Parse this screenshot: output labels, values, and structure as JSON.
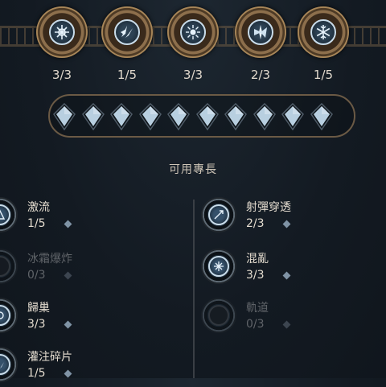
{
  "trees": [
    {
      "icon": "snowflake-wheel-icon",
      "count": "3/3"
    },
    {
      "icon": "ice-shards-icon",
      "count": "1/5"
    },
    {
      "icon": "frost-burst-icon",
      "count": "3/3"
    },
    {
      "icon": "ice-spikes-icon",
      "count": "2/3"
    },
    {
      "icon": "snowflake-icon",
      "count": "1/5"
    }
  ],
  "specialty_pips": {
    "filled": 10,
    "total": 10
  },
  "section_title": "可用專長",
  "talents_left": [
    {
      "name": "激流",
      "rank": "1/5",
      "locked": false
    },
    {
      "name": "冰霜爆炸",
      "rank": "0/3",
      "locked": true
    },
    {
      "name": "歸巢",
      "rank": "3/3",
      "locked": false
    },
    {
      "name": "灌注碎片",
      "rank": "1/5",
      "locked": false
    }
  ],
  "talents_right": [
    {
      "name": "射彈穿透",
      "rank": "2/3",
      "locked": false
    },
    {
      "name": "混亂",
      "rank": "3/3",
      "locked": false
    },
    {
      "name": "軌道",
      "rank": "0/3",
      "locked": true
    }
  ],
  "colors": {
    "accent_ice": "#c9dcea",
    "frame_bronze": "#8d6f4c",
    "background": "#131b23"
  }
}
